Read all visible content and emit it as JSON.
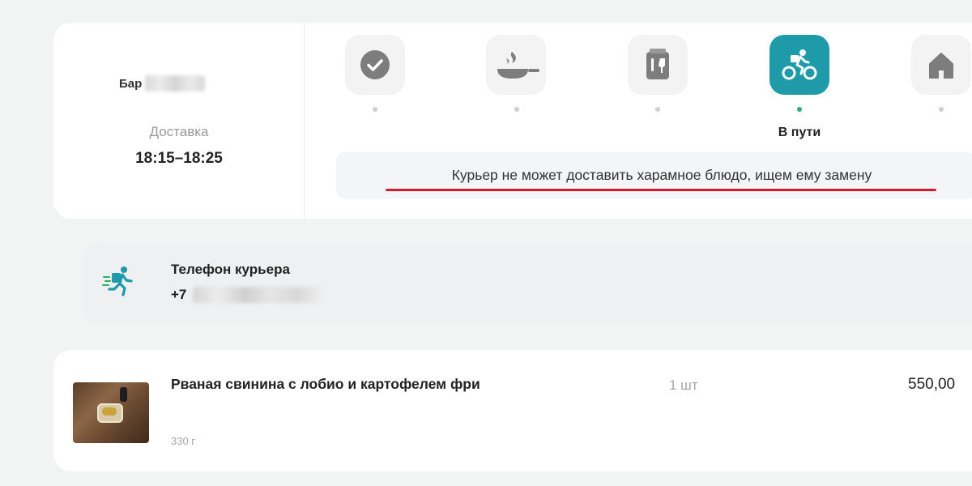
{
  "order": {
    "shop_name": "Бар",
    "delivery_label": "Доставка",
    "delivery_time": "18:15–18:25"
  },
  "steps": [
    {
      "icon": "check-icon",
      "active": false
    },
    {
      "icon": "frying-pan-icon",
      "active": false
    },
    {
      "icon": "packaging-icon",
      "active": false
    },
    {
      "icon": "bicycle-courier-icon",
      "active": true
    },
    {
      "icon": "home-icon",
      "active": false
    }
  ],
  "current_step_label": "В пути",
  "status_message": "Курьер не может доставить харамное блюдо, ищем ему замену",
  "courier": {
    "title": "Телефон курьера",
    "phone_prefix": "+7"
  },
  "item": {
    "name": "Рваная свинина с лобио и картофелем фри",
    "weight": "330 г",
    "quantity": "1 шт",
    "price": "550,00"
  },
  "colors": {
    "accent": "#1e9aa8",
    "active_dot": "#27b36b",
    "underline": "#d81b2a"
  }
}
